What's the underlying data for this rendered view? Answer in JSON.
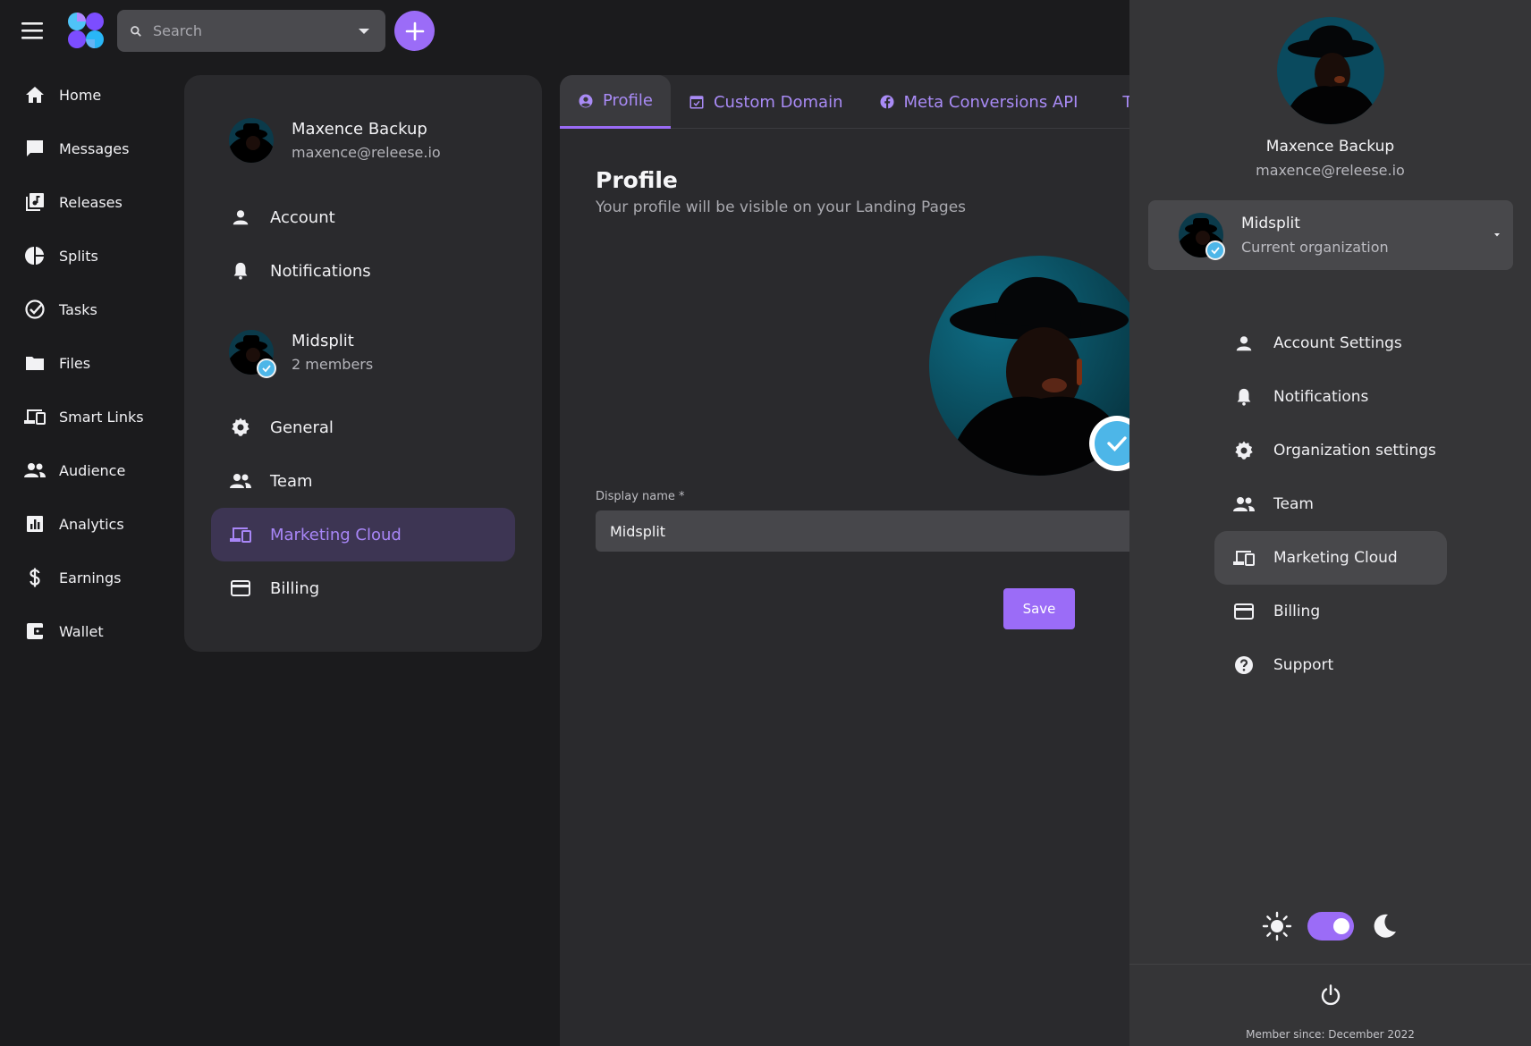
{
  "search": {
    "placeholder": "Search"
  },
  "nav": [
    {
      "label": "Home",
      "icon": "home-icon"
    },
    {
      "label": "Messages",
      "icon": "message-icon"
    },
    {
      "label": "Releases",
      "icon": "music-library-icon"
    },
    {
      "label": "Splits",
      "icon": "pie-chart-icon"
    },
    {
      "label": "Tasks",
      "icon": "check-circle-icon"
    },
    {
      "label": "Files",
      "icon": "folder-icon"
    },
    {
      "label": "Smart Links",
      "icon": "devices-icon"
    },
    {
      "label": "Audience",
      "icon": "people-icon"
    },
    {
      "label": "Analytics",
      "icon": "bar-chart-icon"
    },
    {
      "label": "Earnings",
      "icon": "dollar-icon"
    },
    {
      "label": "Wallet",
      "icon": "wallet-icon"
    }
  ],
  "settings_menu": {
    "user": {
      "name": "Maxence Backup",
      "email": "maxence@releese.io"
    },
    "account_items": [
      {
        "label": "Account",
        "icon": "person-icon"
      },
      {
        "label": "Notifications",
        "icon": "bell-icon"
      }
    ],
    "org": {
      "name": "Midsplit",
      "members": "2 members"
    },
    "org_items": [
      {
        "label": "General",
        "icon": "gear-icon"
      },
      {
        "label": "Team",
        "icon": "people-icon"
      },
      {
        "label": "Marketing Cloud",
        "icon": "devices-icon",
        "active": true
      },
      {
        "label": "Billing",
        "icon": "credit-card-icon"
      }
    ]
  },
  "tabs": [
    {
      "label": "Profile",
      "icon": "account-circle-icon",
      "active": true
    },
    {
      "label": "Custom Domain",
      "icon": "calendar-check-icon"
    },
    {
      "label": "Meta Conversions API",
      "icon": "facebook-icon"
    },
    {
      "label": "Ti",
      "icon": "tiktok-icon"
    }
  ],
  "profile": {
    "title": "Profile",
    "subtitle": "Your profile will be visible on your Landing Pages",
    "display_name_label": "Display name *",
    "display_name_value": "Midsplit",
    "save_label": "Save"
  },
  "drawer": {
    "name": "Maxence Backup",
    "email": "maxence@releese.io",
    "org": {
      "name": "Midsplit",
      "sub": "Current organization"
    },
    "items": [
      {
        "label": "Account Settings",
        "icon": "person-icon"
      },
      {
        "label": "Notifications",
        "icon": "bell-icon"
      },
      {
        "label": "Organization settings",
        "icon": "gear-icon"
      },
      {
        "label": "Team",
        "icon": "people-icon"
      },
      {
        "label": "Marketing Cloud",
        "icon": "devices-icon",
        "active": true
      },
      {
        "label": "Billing",
        "icon": "credit-card-icon"
      },
      {
        "label": "Support",
        "icon": "help-icon"
      }
    ],
    "theme": "dark",
    "member_since": "Member since:  December 2022"
  },
  "colors": {
    "accent": "#9b6cf7",
    "accent_text": "#a886f7",
    "verified": "#4db6e8",
    "background": "#1b1b1d",
    "panel": "#2a2a2d",
    "drawer": "#353537"
  }
}
